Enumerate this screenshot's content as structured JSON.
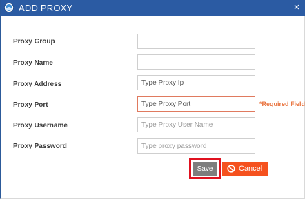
{
  "dialog": {
    "title": "ADD PROXY",
    "close_symbol": "×",
    "icons": {
      "title_icon": "app-globe-icon",
      "close_icon": "close-icon",
      "cancel_icon": "ban-icon"
    }
  },
  "form": {
    "fields": [
      {
        "label": "Proxy Group",
        "value": "",
        "placeholder": ""
      },
      {
        "label": "Proxy Name",
        "value": "",
        "placeholder": ""
      },
      {
        "label": "Proxy Address",
        "value": "",
        "placeholder": "Type Proxy Ip"
      },
      {
        "label": "Proxy Port",
        "value": "",
        "placeholder": "Type Proxy Port"
      },
      {
        "label": "Proxy Username",
        "value": "",
        "placeholder": "Type Proxy User Name"
      },
      {
        "label": "Proxy Password",
        "value": "",
        "placeholder": "Type proxy password"
      }
    ],
    "required_note": "*Required Field"
  },
  "actions": {
    "save_label": "Save",
    "cancel_label": "Cancel"
  },
  "colors": {
    "titlebar": "#2b5ba3",
    "save_button": "#7d7d7d",
    "cancel_button": "#f5511e",
    "save_highlight": "#e0111f",
    "required": "#e8703a"
  }
}
